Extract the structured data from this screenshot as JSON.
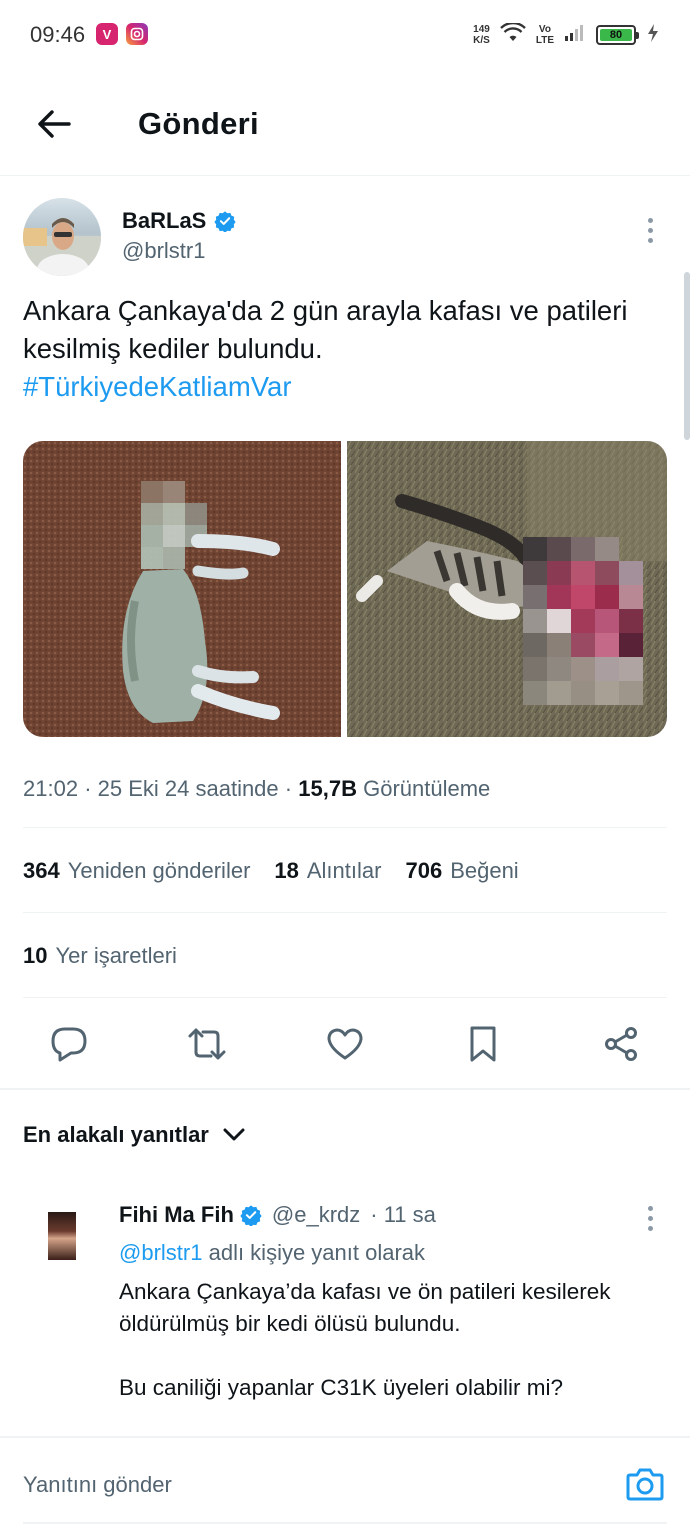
{
  "status_bar": {
    "time": "09:46",
    "speed_value": "149",
    "speed_unit": "K/S",
    "volte_top": "Vo",
    "volte_bottom": "LTE",
    "battery": "80",
    "icons": [
      "vivo-icon",
      "instagram-icon",
      "wifi-icon",
      "signal-icon",
      "battery-icon",
      "charging-icon"
    ]
  },
  "header": {
    "title": "Gönderi"
  },
  "tweet": {
    "author_name": "BaRLaS",
    "author_handle": "@brlstr1",
    "text": "Ankara Çankaya'da 2 gün arayla kafası ve patileri kesilmiş kediler bulundu.",
    "hashtag": "#TürkiyedeKatliamVar",
    "time": "21:02",
    "date": "25 Eki 24 saatinde",
    "views_count": "15,7B",
    "views_label": "Görüntüleme",
    "stats": {
      "reposts_count": "364",
      "reposts_label": "Yeniden gönderiler",
      "quotes_count": "18",
      "quotes_label": "Alıntılar",
      "likes_count": "706",
      "likes_label": "Beğeni",
      "bookmarks_count": "10",
      "bookmarks_label": "Yer işaretleri"
    }
  },
  "replies": {
    "sort_label": "En alakalı yanıtlar",
    "items": [
      {
        "name": "Fihi Ma Fih",
        "handle": "@e_krdz",
        "time": "· 11 sa",
        "reply_to_handle": "@brlstr1",
        "reply_to_suffix": "adlı kişiye yanıt olarak",
        "text": "Ankara Çankaya’da kafası ve ön patileri kesilerek öldürülmüş bir kedi ölüsü bulundu.\n\nBu caniliği yapanlar C31K üyeleri olabilir mi?"
      }
    ]
  },
  "composer": {
    "placeholder": "Yanıtını gönder"
  },
  "colors": {
    "accent": "#1d9bf0",
    "text_primary": "#0f1419",
    "text_secondary": "#536471",
    "divider": "#eff3f4"
  }
}
